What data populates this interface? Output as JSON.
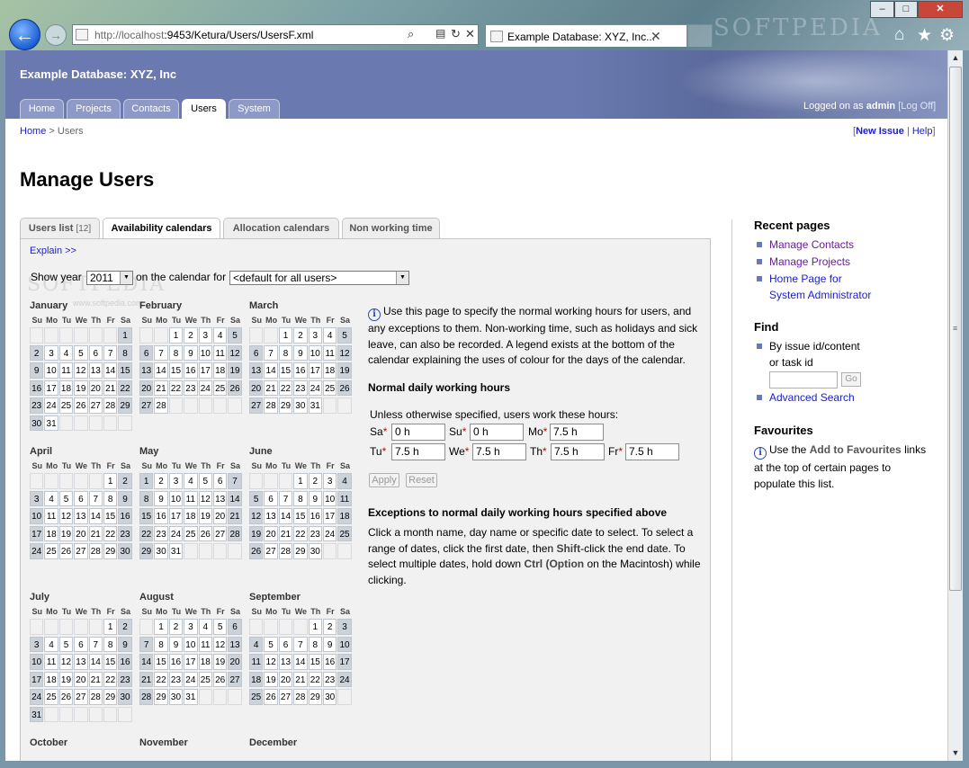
{
  "browser": {
    "url_prefix": "http://localhost",
    "url_rest": ":9453/Ketura/Users/UsersF.xml",
    "tab_title": "Example Database: XYZ, Inc...",
    "watermark": "SOFTPEDIA"
  },
  "site": {
    "title": "Example Database: XYZ, Inc",
    "nav": [
      "Home",
      "Projects",
      "Contacts",
      "Users",
      "System"
    ],
    "logon_prefix": "Logged on as",
    "logon_user": "admin",
    "logoff": "[Log Off]"
  },
  "breadcrumb": {
    "home": "Home",
    "sep": ">",
    "current": "Users"
  },
  "toplinks": {
    "open": "[",
    "new_issue": "New Issue",
    "sep": "|",
    "help": "Help",
    "close": "]"
  },
  "page_title": "Manage Users",
  "tabs": {
    "users_list": "Users list",
    "users_count": "[12]",
    "availability": "Availability calendars",
    "allocation": "Allocation calendars",
    "non_working": "Non working time"
  },
  "panel": {
    "explain": "Explain >>",
    "show_year": "Show year",
    "year": "2011",
    "on_calendar_for": "on the calendar for",
    "user_select": "<default for all users>",
    "watermark_small": "www.softpedia.com"
  },
  "calendar": {
    "dows": [
      "Su",
      "Mo",
      "Tu",
      "We",
      "Th",
      "Fr",
      "Sa"
    ],
    "months": [
      "January",
      "February",
      "March",
      "April",
      "May",
      "June",
      "July",
      "August",
      "September",
      "October",
      "November",
      "December"
    ]
  },
  "info": {
    "intro": "Use this page to specify the normal working hours for users, and any exceptions to them. Non-working time, such as holidays and sick leave, can also be recorded. A legend exists at the bottom of the calendar explaining the uses of colour for the days of the calendar.",
    "normal_heading": "Normal daily working hours",
    "unless": "Unless otherwise specified, users work these hours:",
    "labels": {
      "sa": "Sa",
      "su": "Su",
      "mo": "Mo",
      "tu": "Tu",
      "we": "We",
      "th": "Th",
      "fr": "Fr",
      "star": "*"
    },
    "hours": {
      "sa": "0 h",
      "su": "0 h",
      "mo": "7.5 h",
      "tu": "7.5 h",
      "we": "7.5 h",
      "th": "7.5 h",
      "fr": "7.5 h"
    },
    "apply": "Apply",
    "reset": "Reset",
    "exceptions_heading": "Exceptions to normal daily working hours specified above",
    "exc_1": "Click a month name, day name or specific date to select. To select a range of dates, click the first date, then",
    "exc_shift": "Shift",
    "exc_2": "-click the end date. To select multiple dates, hold down",
    "exc_ctrl": "Ctrl (Option",
    "exc_3": "on the Macintosh) while clicking."
  },
  "sidebar": {
    "recent_heading": "Recent pages",
    "recent": [
      "Manage Contacts",
      "Manage Projects",
      "Home Page for",
      "System Administrator"
    ],
    "find_heading": "Find",
    "find_label_1": "By issue id/content",
    "find_label_2": "or task id",
    "go": "Go",
    "advanced": "Advanced Search",
    "fav_heading": "Favourites",
    "fav_1": "Use the",
    "fav_link": "Add to Favourites",
    "fav_2": "links at the top of certain pages to populate this list."
  }
}
